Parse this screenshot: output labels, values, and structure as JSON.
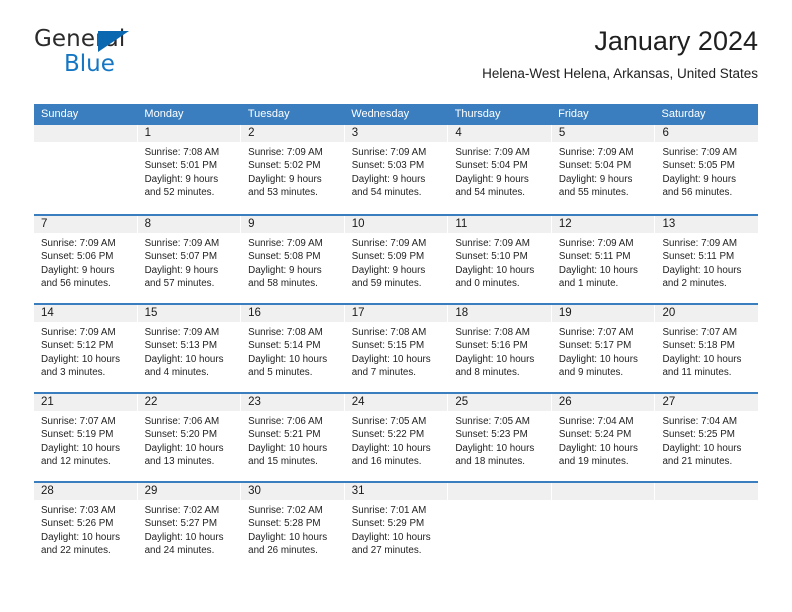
{
  "brand": {
    "name_part1": "General",
    "name_part2": "Blue",
    "triangle_color": "#0a68b0",
    "blue_text_color": "#1577c4"
  },
  "header": {
    "title": "January 2024",
    "subtitle": "Helena-West Helena, Arkansas, United States"
  },
  "theme": {
    "header_bar_color": "#3a7ebf",
    "day_number_band_color": "#f0f0f0",
    "week_divider_color": "#3a7ebf",
    "cell_background": "#ffffff",
    "text_color": "#232323"
  },
  "weekdays": [
    "Sunday",
    "Monday",
    "Tuesday",
    "Wednesday",
    "Thursday",
    "Friday",
    "Saturday"
  ],
  "weeks": [
    [
      {
        "date": "",
        "sunrise": "",
        "sunset": "",
        "daylight": "",
        "empty": true
      },
      {
        "date": "1",
        "sunrise": "Sunrise: 7:08 AM",
        "sunset": "Sunset: 5:01 PM",
        "daylight": "Daylight: 9 hours and 52 minutes."
      },
      {
        "date": "2",
        "sunrise": "Sunrise: 7:09 AM",
        "sunset": "Sunset: 5:02 PM",
        "daylight": "Daylight: 9 hours and 53 minutes."
      },
      {
        "date": "3",
        "sunrise": "Sunrise: 7:09 AM",
        "sunset": "Sunset: 5:03 PM",
        "daylight": "Daylight: 9 hours and 54 minutes."
      },
      {
        "date": "4",
        "sunrise": "Sunrise: 7:09 AM",
        "sunset": "Sunset: 5:04 PM",
        "daylight": "Daylight: 9 hours and 54 minutes."
      },
      {
        "date": "5",
        "sunrise": "Sunrise: 7:09 AM",
        "sunset": "Sunset: 5:04 PM",
        "daylight": "Daylight: 9 hours and 55 minutes."
      },
      {
        "date": "6",
        "sunrise": "Sunrise: 7:09 AM",
        "sunset": "Sunset: 5:05 PM",
        "daylight": "Daylight: 9 hours and 56 minutes."
      }
    ],
    [
      {
        "date": "7",
        "sunrise": "Sunrise: 7:09 AM",
        "sunset": "Sunset: 5:06 PM",
        "daylight": "Daylight: 9 hours and 56 minutes."
      },
      {
        "date": "8",
        "sunrise": "Sunrise: 7:09 AM",
        "sunset": "Sunset: 5:07 PM",
        "daylight": "Daylight: 9 hours and 57 minutes."
      },
      {
        "date": "9",
        "sunrise": "Sunrise: 7:09 AM",
        "sunset": "Sunset: 5:08 PM",
        "daylight": "Daylight: 9 hours and 58 minutes."
      },
      {
        "date": "10",
        "sunrise": "Sunrise: 7:09 AM",
        "sunset": "Sunset: 5:09 PM",
        "daylight": "Daylight: 9 hours and 59 minutes."
      },
      {
        "date": "11",
        "sunrise": "Sunrise: 7:09 AM",
        "sunset": "Sunset: 5:10 PM",
        "daylight": "Daylight: 10 hours and 0 minutes."
      },
      {
        "date": "12",
        "sunrise": "Sunrise: 7:09 AM",
        "sunset": "Sunset: 5:11 PM",
        "daylight": "Daylight: 10 hours and 1 minute."
      },
      {
        "date": "13",
        "sunrise": "Sunrise: 7:09 AM",
        "sunset": "Sunset: 5:11 PM",
        "daylight": "Daylight: 10 hours and 2 minutes."
      }
    ],
    [
      {
        "date": "14",
        "sunrise": "Sunrise: 7:09 AM",
        "sunset": "Sunset: 5:12 PM",
        "daylight": "Daylight: 10 hours and 3 minutes."
      },
      {
        "date": "15",
        "sunrise": "Sunrise: 7:09 AM",
        "sunset": "Sunset: 5:13 PM",
        "daylight": "Daylight: 10 hours and 4 minutes."
      },
      {
        "date": "16",
        "sunrise": "Sunrise: 7:08 AM",
        "sunset": "Sunset: 5:14 PM",
        "daylight": "Daylight: 10 hours and 5 minutes."
      },
      {
        "date": "17",
        "sunrise": "Sunrise: 7:08 AM",
        "sunset": "Sunset: 5:15 PM",
        "daylight": "Daylight: 10 hours and 7 minutes."
      },
      {
        "date": "18",
        "sunrise": "Sunrise: 7:08 AM",
        "sunset": "Sunset: 5:16 PM",
        "daylight": "Daylight: 10 hours and 8 minutes."
      },
      {
        "date": "19",
        "sunrise": "Sunrise: 7:07 AM",
        "sunset": "Sunset: 5:17 PM",
        "daylight": "Daylight: 10 hours and 9 minutes."
      },
      {
        "date": "20",
        "sunrise": "Sunrise: 7:07 AM",
        "sunset": "Sunset: 5:18 PM",
        "daylight": "Daylight: 10 hours and 11 minutes."
      }
    ],
    [
      {
        "date": "21",
        "sunrise": "Sunrise: 7:07 AM",
        "sunset": "Sunset: 5:19 PM",
        "daylight": "Daylight: 10 hours and 12 minutes."
      },
      {
        "date": "22",
        "sunrise": "Sunrise: 7:06 AM",
        "sunset": "Sunset: 5:20 PM",
        "daylight": "Daylight: 10 hours and 13 minutes."
      },
      {
        "date": "23",
        "sunrise": "Sunrise: 7:06 AM",
        "sunset": "Sunset: 5:21 PM",
        "daylight": "Daylight: 10 hours and 15 minutes."
      },
      {
        "date": "24",
        "sunrise": "Sunrise: 7:05 AM",
        "sunset": "Sunset: 5:22 PM",
        "daylight": "Daylight: 10 hours and 16 minutes."
      },
      {
        "date": "25",
        "sunrise": "Sunrise: 7:05 AM",
        "sunset": "Sunset: 5:23 PM",
        "daylight": "Daylight: 10 hours and 18 minutes."
      },
      {
        "date": "26",
        "sunrise": "Sunrise: 7:04 AM",
        "sunset": "Sunset: 5:24 PM",
        "daylight": "Daylight: 10 hours and 19 minutes."
      },
      {
        "date": "27",
        "sunrise": "Sunrise: 7:04 AM",
        "sunset": "Sunset: 5:25 PM",
        "daylight": "Daylight: 10 hours and 21 minutes."
      }
    ],
    [
      {
        "date": "28",
        "sunrise": "Sunrise: 7:03 AM",
        "sunset": "Sunset: 5:26 PM",
        "daylight": "Daylight: 10 hours and 22 minutes."
      },
      {
        "date": "29",
        "sunrise": "Sunrise: 7:02 AM",
        "sunset": "Sunset: 5:27 PM",
        "daylight": "Daylight: 10 hours and 24 minutes."
      },
      {
        "date": "30",
        "sunrise": "Sunrise: 7:02 AM",
        "sunset": "Sunset: 5:28 PM",
        "daylight": "Daylight: 10 hours and 26 minutes."
      },
      {
        "date": "31",
        "sunrise": "Sunrise: 7:01 AM",
        "sunset": "Sunset: 5:29 PM",
        "daylight": "Daylight: 10 hours and 27 minutes."
      },
      {
        "date": "",
        "sunrise": "",
        "sunset": "",
        "daylight": "",
        "empty": true
      },
      {
        "date": "",
        "sunrise": "",
        "sunset": "",
        "daylight": "",
        "empty": true
      },
      {
        "date": "",
        "sunrise": "",
        "sunset": "",
        "daylight": "",
        "empty": true
      }
    ]
  ]
}
